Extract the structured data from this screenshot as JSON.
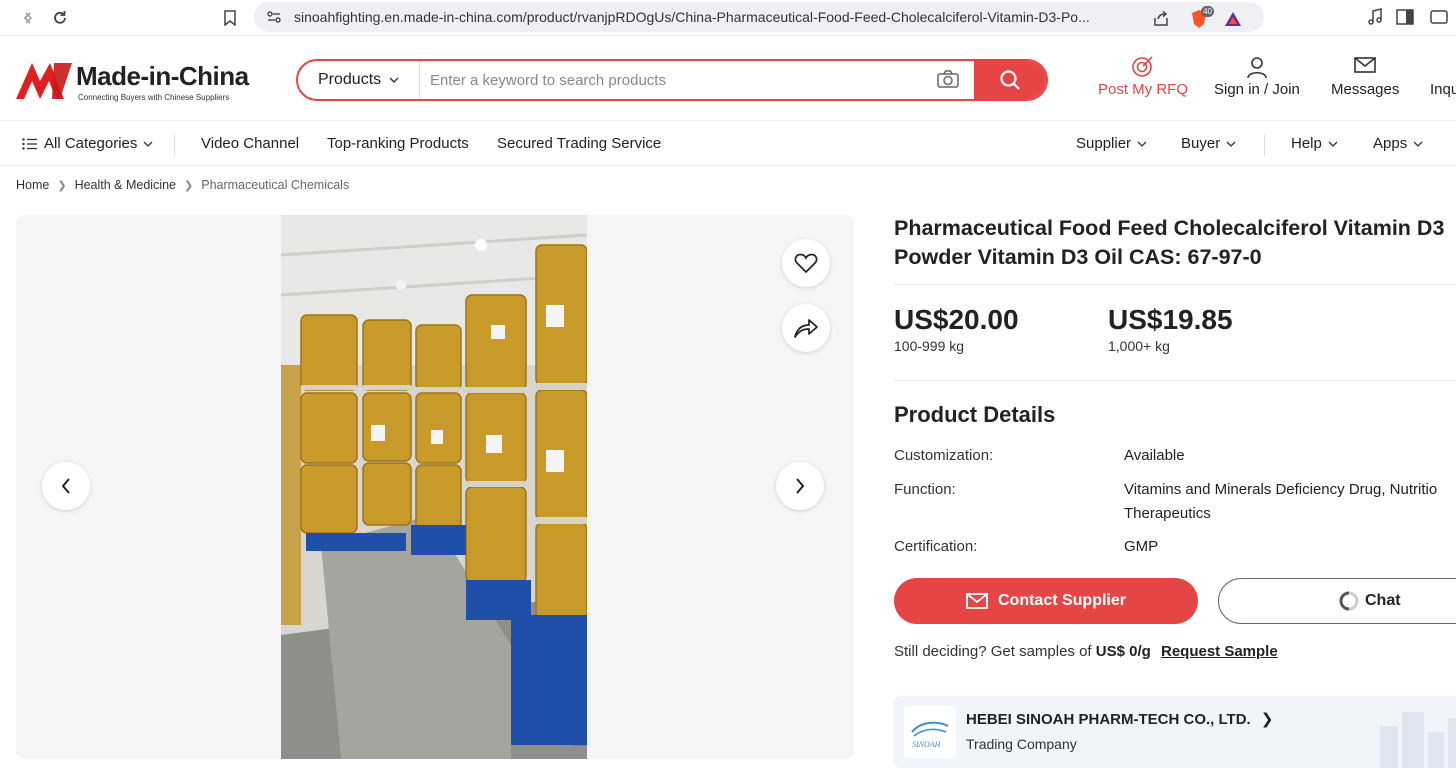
{
  "browser": {
    "url": "sinoahfighting.en.made-in-china.com/product/rvanjpRDOgUs/China-Pharmaceutical-Food-Feed-Cholecalciferol-Vitamin-D3-Po...",
    "brave_count": "40"
  },
  "header": {
    "logo_text": "Made-in-China",
    "logo_tagline": "Connecting Buyers with Chinese Suppliers",
    "search_category": "Products",
    "search_placeholder": "Enter a keyword to search products",
    "post_rfq": "Post My RFQ",
    "sign_in": "Sign in / Join",
    "messages": "Messages",
    "inquiry": "Inqu"
  },
  "nav": {
    "all_categories": "All Categories",
    "video_channel": "Video Channel",
    "top_ranking": "Top-ranking Products",
    "secured_trading": "Secured Trading Service",
    "supplier": "Supplier",
    "buyer": "Buyer",
    "help": "Help",
    "apps": "Apps"
  },
  "breadcrumb": [
    "Home",
    "Health & Medicine",
    "Pharmaceutical Chemicals"
  ],
  "product": {
    "title": "Pharmaceutical Food Feed Cholecalciferol Vitamin D3 Powder Vitamin D3 Oil CAS: 67-97-0",
    "prices": [
      {
        "amount": "US$20.00",
        "qty": "100-999 kg"
      },
      {
        "amount": "US$19.85",
        "qty": "1,000+ kg"
      }
    ],
    "details_heading": "Product Details",
    "details": [
      {
        "label": "Customization:",
        "value": "Available"
      },
      {
        "label": "Function:",
        "value": "Vitamins and Minerals Deficiency Drug, Nutritio",
        "value2": "Therapeutics"
      },
      {
        "label": "Certification:",
        "value": "GMP"
      }
    ],
    "contact_label": "Contact Supplier",
    "chat_label": "Chat",
    "sample_prefix": "Still deciding? Get samples of",
    "sample_price": "US$ 0/g",
    "request_sample": "Request Sample"
  },
  "supplier": {
    "name": "HEBEI SINOAH PHARM-TECH CO., LTD.",
    "type": "Trading Company",
    "logo_text": "SINOAH"
  },
  "colors": {
    "accent": "#e64545",
    "barrel": "#c89a2a",
    "pallet": "#1f4fa8"
  }
}
